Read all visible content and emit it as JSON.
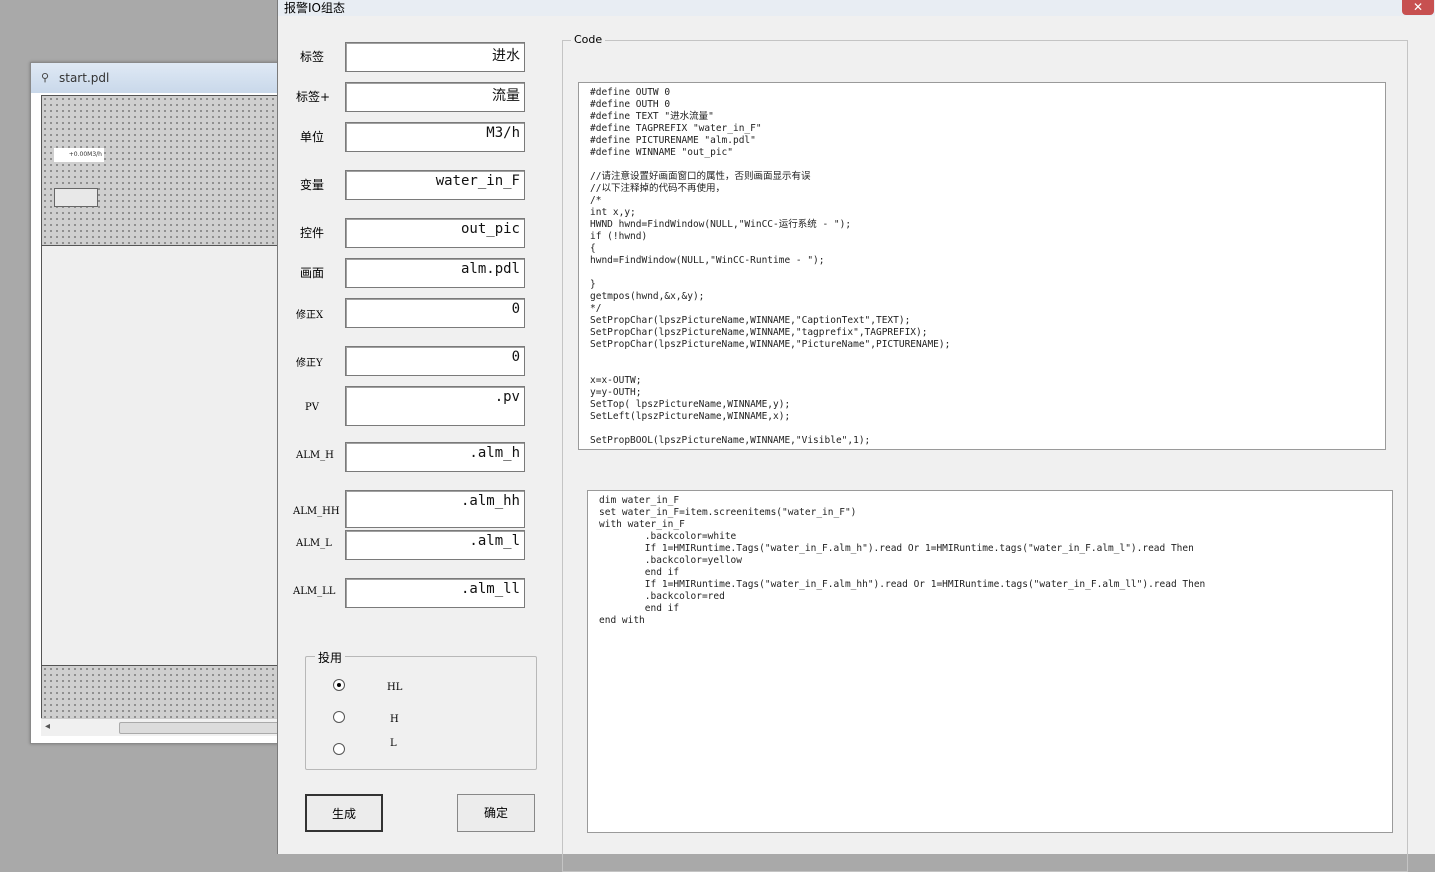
{
  "background_window": {
    "title": "start.pdl",
    "io_field_value": "+0.00M3/h"
  },
  "dialog": {
    "title": "报警IO组态",
    "close_label": "✕",
    "fields": [
      {
        "label": "标签",
        "value": "进水"
      },
      {
        "label": "标签+",
        "value": "流量"
      },
      {
        "label": "单位",
        "value": "M3/h"
      },
      {
        "label": "变量",
        "value": "water_in_F"
      },
      {
        "label": "控件",
        "value": "out_pic"
      },
      {
        "label": "画面",
        "value": "alm.pdl"
      },
      {
        "label": "修正X",
        "value": "0"
      },
      {
        "label": "修正Y",
        "value": "0"
      },
      {
        "label": "PV",
        "value": ".pv"
      },
      {
        "label": "ALM_H",
        "value": ".alm_h"
      },
      {
        "label": "ALM_HH",
        "value": ".alm_hh"
      },
      {
        "label": "ALM_L",
        "value": ".alm_l"
      },
      {
        "label": "ALM_LL",
        "value": ".alm_ll"
      }
    ],
    "enable_group": {
      "title": "投用",
      "options": [
        {
          "label": "HL",
          "selected": true
        },
        {
          "label": "H",
          "selected": false
        },
        {
          "label": "L",
          "selected": false
        }
      ]
    },
    "buttons": {
      "generate": "生成",
      "ok": "确定"
    },
    "code_group_title": "Code",
    "code_c": "#define OUTW 0\n#define OUTH 0\n#define TEXT \"进水流量\"\n#define TAGPREFIX \"water_in_F\"\n#define PICTURENAME \"alm.pdl\"\n#define WINNAME \"out_pic\"\n\n//请注意设置好画面窗口的属性，否则画面显示有误\n//以下注释掉的代码不再使用，\n/*\nint x,y;\nHWND hwnd=FindWindow(NULL,\"WinCC-运行系统 - \");\nif (!hwnd)\n{\nhwnd=FindWindow(NULL,\"WinCC-Runtime - \");\n\n}\ngetmpos(hwnd,&x,&y);\n*/\nSetPropChar(lpszPictureName,WINNAME,\"CaptionText\",TEXT);\nSetPropChar(lpszPictureName,WINNAME,\"tagprefix\",TAGPREFIX);\nSetPropChar(lpszPictureName,WINNAME,\"PictureName\",PICTURENAME);\n\n\nx=x-OUTW;\ny=y-OUTH;\nSetTop( lpszPictureName,WINNAME,y);\nSetLeft(lpszPictureName,WINNAME,x);\n\nSetPropBOOL(lpszPictureName,WINNAME,\"Visible\",1);",
    "code_vbs": "dim water_in_F\nset water_in_F=item.screenitems(\"water_in_F\")\nwith water_in_F\n        .backcolor=white\n        If 1=HMIRuntime.Tags(\"water_in_F.alm_h\").read Or 1=HMIRuntime.tags(\"water_in_F.alm_l\").read Then\n        .backcolor=yellow\n        end if\n        If 1=HMIRuntime.Tags(\"water_in_F.alm_hh\").read Or 1=HMIRuntime.tags(\"water_in_F.alm_ll\").read Then\n        .backcolor=red\n        end if\nend with"
  }
}
